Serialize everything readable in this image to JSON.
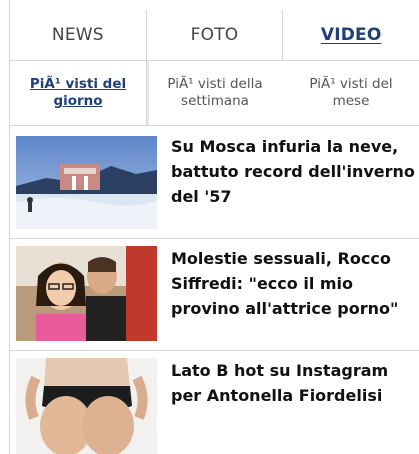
{
  "main_tabs": [
    {
      "label": "NEWS",
      "active": false
    },
    {
      "label": "FOTO",
      "active": false
    },
    {
      "label": "VIDEO",
      "active": true
    }
  ],
  "sub_tabs": [
    {
      "label": "PiÃ¹ visti del giorno",
      "active": true
    },
    {
      "label": "PiÃ¹ visti della settimana",
      "active": false
    },
    {
      "label": "PiÃ¹ visti del mese",
      "active": false
    }
  ],
  "news": [
    {
      "headline": "Su Mosca infuria la neve, battuto record dell'inverno del '57"
    },
    {
      "headline": "Molestie sessuali, Rocco Siffredi: \"ecco il mio provino all'attrice porno\""
    },
    {
      "headline": "Lato B hot su Instagram per Antonella Fiordelisi"
    }
  ],
  "colors": {
    "accent": "#1f3f7a",
    "divider": "#d6d6d6"
  }
}
